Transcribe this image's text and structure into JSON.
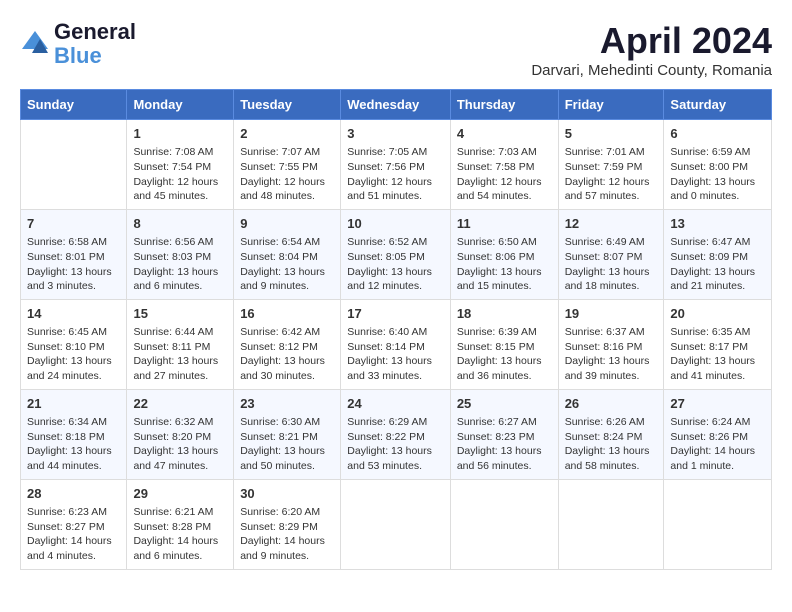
{
  "header": {
    "logo_line1": "General",
    "logo_line2": "Blue",
    "month": "April 2024",
    "location": "Darvari, Mehedinti County, Romania"
  },
  "days_of_week": [
    "Sunday",
    "Monday",
    "Tuesday",
    "Wednesday",
    "Thursday",
    "Friday",
    "Saturday"
  ],
  "weeks": [
    [
      {
        "day": "",
        "info": ""
      },
      {
        "day": "1",
        "info": "Sunrise: 7:08 AM\nSunset: 7:54 PM\nDaylight: 12 hours\nand 45 minutes."
      },
      {
        "day": "2",
        "info": "Sunrise: 7:07 AM\nSunset: 7:55 PM\nDaylight: 12 hours\nand 48 minutes."
      },
      {
        "day": "3",
        "info": "Sunrise: 7:05 AM\nSunset: 7:56 PM\nDaylight: 12 hours\nand 51 minutes."
      },
      {
        "day": "4",
        "info": "Sunrise: 7:03 AM\nSunset: 7:58 PM\nDaylight: 12 hours\nand 54 minutes."
      },
      {
        "day": "5",
        "info": "Sunrise: 7:01 AM\nSunset: 7:59 PM\nDaylight: 12 hours\nand 57 minutes."
      },
      {
        "day": "6",
        "info": "Sunrise: 6:59 AM\nSunset: 8:00 PM\nDaylight: 13 hours\nand 0 minutes."
      }
    ],
    [
      {
        "day": "7",
        "info": "Sunrise: 6:58 AM\nSunset: 8:01 PM\nDaylight: 13 hours\nand 3 minutes."
      },
      {
        "day": "8",
        "info": "Sunrise: 6:56 AM\nSunset: 8:03 PM\nDaylight: 13 hours\nand 6 minutes."
      },
      {
        "day": "9",
        "info": "Sunrise: 6:54 AM\nSunset: 8:04 PM\nDaylight: 13 hours\nand 9 minutes."
      },
      {
        "day": "10",
        "info": "Sunrise: 6:52 AM\nSunset: 8:05 PM\nDaylight: 13 hours\nand 12 minutes."
      },
      {
        "day": "11",
        "info": "Sunrise: 6:50 AM\nSunset: 8:06 PM\nDaylight: 13 hours\nand 15 minutes."
      },
      {
        "day": "12",
        "info": "Sunrise: 6:49 AM\nSunset: 8:07 PM\nDaylight: 13 hours\nand 18 minutes."
      },
      {
        "day": "13",
        "info": "Sunrise: 6:47 AM\nSunset: 8:09 PM\nDaylight: 13 hours\nand 21 minutes."
      }
    ],
    [
      {
        "day": "14",
        "info": "Sunrise: 6:45 AM\nSunset: 8:10 PM\nDaylight: 13 hours\nand 24 minutes."
      },
      {
        "day": "15",
        "info": "Sunrise: 6:44 AM\nSunset: 8:11 PM\nDaylight: 13 hours\nand 27 minutes."
      },
      {
        "day": "16",
        "info": "Sunrise: 6:42 AM\nSunset: 8:12 PM\nDaylight: 13 hours\nand 30 minutes."
      },
      {
        "day": "17",
        "info": "Sunrise: 6:40 AM\nSunset: 8:14 PM\nDaylight: 13 hours\nand 33 minutes."
      },
      {
        "day": "18",
        "info": "Sunrise: 6:39 AM\nSunset: 8:15 PM\nDaylight: 13 hours\nand 36 minutes."
      },
      {
        "day": "19",
        "info": "Sunrise: 6:37 AM\nSunset: 8:16 PM\nDaylight: 13 hours\nand 39 minutes."
      },
      {
        "day": "20",
        "info": "Sunrise: 6:35 AM\nSunset: 8:17 PM\nDaylight: 13 hours\nand 41 minutes."
      }
    ],
    [
      {
        "day": "21",
        "info": "Sunrise: 6:34 AM\nSunset: 8:18 PM\nDaylight: 13 hours\nand 44 minutes."
      },
      {
        "day": "22",
        "info": "Sunrise: 6:32 AM\nSunset: 8:20 PM\nDaylight: 13 hours\nand 47 minutes."
      },
      {
        "day": "23",
        "info": "Sunrise: 6:30 AM\nSunset: 8:21 PM\nDaylight: 13 hours\nand 50 minutes."
      },
      {
        "day": "24",
        "info": "Sunrise: 6:29 AM\nSunset: 8:22 PM\nDaylight: 13 hours\nand 53 minutes."
      },
      {
        "day": "25",
        "info": "Sunrise: 6:27 AM\nSunset: 8:23 PM\nDaylight: 13 hours\nand 56 minutes."
      },
      {
        "day": "26",
        "info": "Sunrise: 6:26 AM\nSunset: 8:24 PM\nDaylight: 13 hours\nand 58 minutes."
      },
      {
        "day": "27",
        "info": "Sunrise: 6:24 AM\nSunset: 8:26 PM\nDaylight: 14 hours\nand 1 minute."
      }
    ],
    [
      {
        "day": "28",
        "info": "Sunrise: 6:23 AM\nSunset: 8:27 PM\nDaylight: 14 hours\nand 4 minutes."
      },
      {
        "day": "29",
        "info": "Sunrise: 6:21 AM\nSunset: 8:28 PM\nDaylight: 14 hours\nand 6 minutes."
      },
      {
        "day": "30",
        "info": "Sunrise: 6:20 AM\nSunset: 8:29 PM\nDaylight: 14 hours\nand 9 minutes."
      },
      {
        "day": "",
        "info": ""
      },
      {
        "day": "",
        "info": ""
      },
      {
        "day": "",
        "info": ""
      },
      {
        "day": "",
        "info": ""
      }
    ]
  ]
}
